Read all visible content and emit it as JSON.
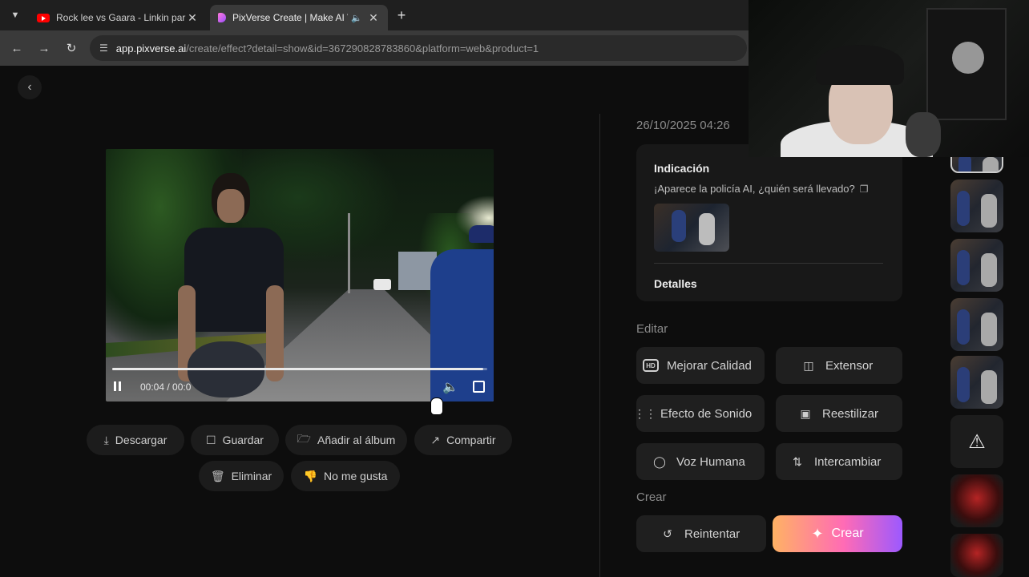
{
  "browser": {
    "tabs": [
      {
        "title": "Rock lee vs Gaara - Linkin park",
        "active": false
      },
      {
        "title": "PixVerse Create | Make AI V",
        "active": true
      }
    ],
    "url_host": "app.pixverse.ai",
    "url_path": "/create/effect?detail=show&id=367290828783860&platform=web&product=1"
  },
  "video": {
    "time": "00:04 / 00:0",
    "progress_fraction": 0.99
  },
  "actions": {
    "download": "Descargar",
    "save": "Guardar",
    "add_album": "Añadir al álbum",
    "share": "Compartir",
    "delete": "Eliminar",
    "dislike": "No me gusta"
  },
  "details": {
    "date": "26/10/2025 04:26",
    "prompt_heading": "Indicación",
    "prompt_text": "¡Aparece la policía AI, ¿quién será llevado?",
    "details_heading": "Detalles"
  },
  "edit": {
    "section_label": "Editar",
    "buttons": {
      "enhance": "Mejorar Calidad",
      "extend": "Extensor",
      "sound": "Efecto de Sonido",
      "restyle": "Reestilizar",
      "voice": "Voz Humana",
      "swap": "Intercambiar"
    }
  },
  "create_section": {
    "section_label": "Crear",
    "retry": "Reintentar",
    "create": "Crear"
  },
  "colors": {
    "create_gradient": [
      "#ffb264",
      "#ff6bb5",
      "#9c59ff"
    ],
    "youtube_red": "#ff0000"
  }
}
